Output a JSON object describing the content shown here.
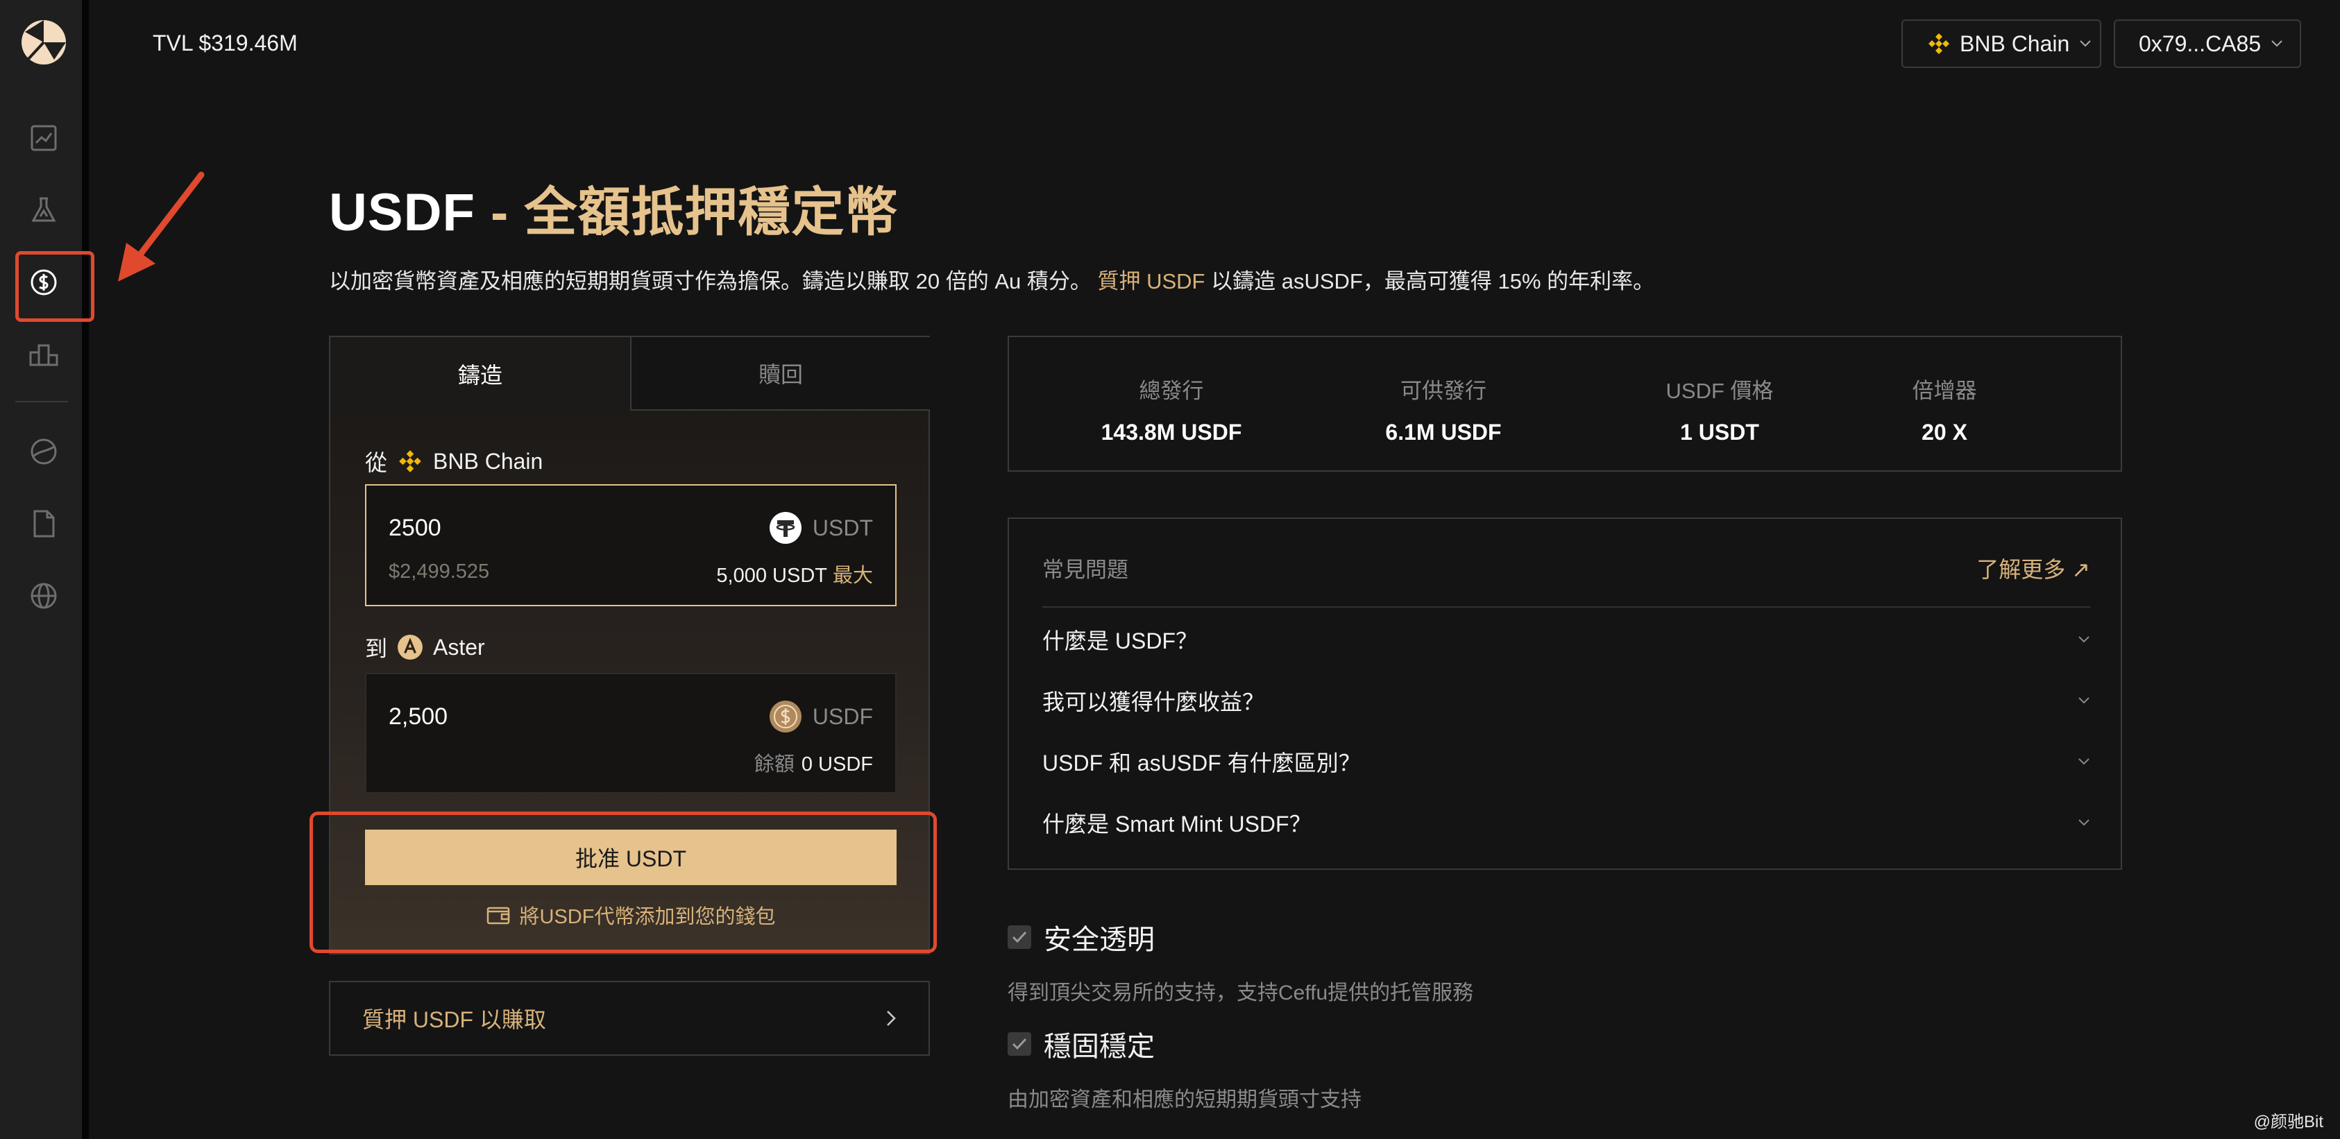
{
  "header": {
    "tvl": "TVL $319.46M",
    "chain_button": "BNB Chain",
    "wallet_button": "0x79...CA85"
  },
  "hero": {
    "title_main": "USDF",
    "title_accent": " - 全額抵押穩定幣",
    "subtitle_pre": "以加密貨幣資產及相應的短期期貨頭寸作為擔保。鑄造以賺取 20 倍的 Au 積分。",
    "subtitle_link": "質押 USDF",
    "subtitle_post": "以鑄造 asUSDF，最高可獲得 15% 的年利率。"
  },
  "mint_panel": {
    "tabs": [
      {
        "label": "鑄造",
        "active": true
      },
      {
        "label": "贖回",
        "active": false
      }
    ],
    "from": {
      "label": "從",
      "chain": "BNB Chain",
      "amount": "2500",
      "usd_value": "$2,499.525",
      "token": "USDT",
      "balance": "5,000 USDT",
      "max_label": "最大"
    },
    "to": {
      "label": "到",
      "chain": "Aster",
      "amount": "2,500",
      "token": "USDF",
      "balance_label": "餘額",
      "balance": "0 USDF"
    },
    "approve_button": "批准 USDT",
    "add_wallet": "將USDF代幣添加到您的錢包"
  },
  "stake_link": "質押 USDF 以賺取",
  "stats": [
    {
      "label": "總發行",
      "value": "143.8M USDF"
    },
    {
      "label": "可供發行",
      "value": "6.1M USDF"
    },
    {
      "label": "USDF 價格",
      "value": "1 USDT"
    },
    {
      "label": "倍增器",
      "value": "20 X"
    }
  ],
  "faq": {
    "title": "常見問題",
    "more": "了解更多 ↗",
    "items": [
      "什麼是 USDF？",
      "我可以獲得什麼收益？",
      "USDF 和 asUSDF 有什麼區別？",
      "什麼是 Smart Mint USDF？"
    ]
  },
  "features": [
    {
      "title": "安全透明",
      "desc": "得到頂尖交易所的支持，支持Ceffu提供的托管服務"
    },
    {
      "title": "穩固穩定",
      "desc": "由加密資產和相應的短期期貨頭寸支持"
    }
  ],
  "watermark": "@颜驰Bit",
  "colors": {
    "accent": "#e6c28d",
    "highlight": "#e0492e",
    "background": "#141414"
  },
  "icons": {
    "sidebar": [
      "chart-icon",
      "flask-icon",
      "dollar-icon",
      "ranking-icon",
      "pie-icon",
      "document-icon",
      "globe-icon"
    ]
  }
}
